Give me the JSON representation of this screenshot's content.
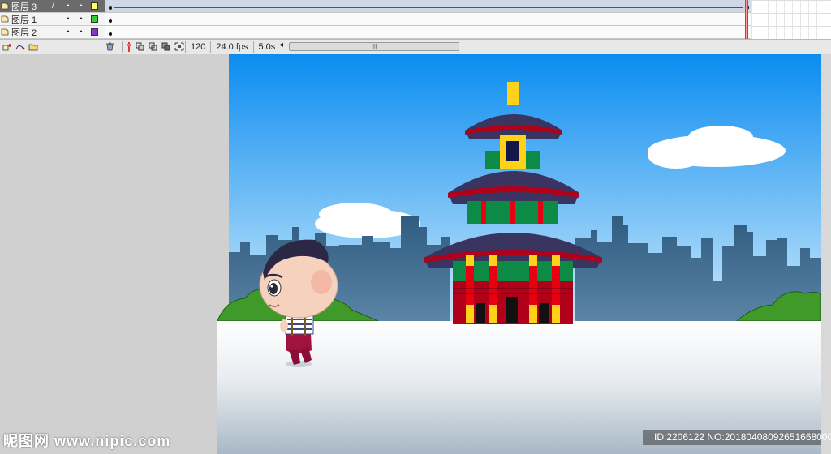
{
  "timeline": {
    "layers": [
      {
        "name": "图层 3",
        "color": "#ffff66",
        "selected": true
      },
      {
        "name": "图层 1",
        "color": "#33cc33",
        "selected": false
      },
      {
        "name": "图层 2",
        "color": "#8833cc",
        "selected": false
      }
    ],
    "pencil": "/",
    "visible_dot": "•",
    "lock_dot": "•",
    "toolbar": {
      "current_frame": "120",
      "frame_rate": "24.0 fps",
      "elapsed_time": "5.0s",
      "scroll_grip": "III",
      "arrow_left": "◂"
    }
  },
  "watermark": {
    "logo": "昵图网 www.nipic.com",
    "id_text": "ID:2206122 NO:20180408092651668000"
  },
  "colors": {
    "sky_top": "#0a8cf0",
    "sky_bottom": "#bfe3f8",
    "building": "#2f5c80",
    "ground": "#f2f4f7",
    "bush": "#3f9a2a",
    "temple_roof": "#3a3560",
    "temple_red": "#e60012",
    "temple_gold": "#ffd21a",
    "temple_green": "#0c8a46"
  }
}
